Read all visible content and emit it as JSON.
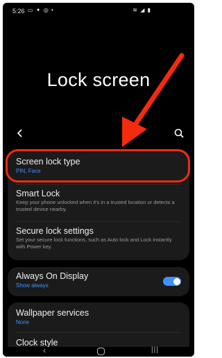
{
  "status_bar": {
    "time": "5:26",
    "left_icons": [
      "gallery-icon",
      "twitter-icon",
      "instagram-icon",
      "dot-icon"
    ],
    "right_icons": [
      "wifi-icon",
      "signal-icon",
      "battery-icon"
    ]
  },
  "header": {
    "title": "Lock screen"
  },
  "settings": {
    "screen_lock_type": {
      "title": "Screen lock type",
      "value": "PIN, Face"
    },
    "smart_lock": {
      "title": "Smart Lock",
      "description": "Keep your phone unlocked when it's in a trusted location or detects a trusted device nearby."
    },
    "secure_lock": {
      "title": "Secure lock settings",
      "description": "Set your secure lock functions, such as Auto lock and Lock instantly with Power key."
    },
    "always_on_display": {
      "title": "Always On Display",
      "value": "Show always",
      "enabled": true
    },
    "wallpaper_services": {
      "title": "Wallpaper services",
      "value": "None"
    },
    "clock_style": {
      "title": "Clock style"
    }
  },
  "colors": {
    "accent": "#3e91ff",
    "annotation": "#f22c0c",
    "card_bg": "#1b1b1b",
    "screen_bg": "#000000"
  }
}
